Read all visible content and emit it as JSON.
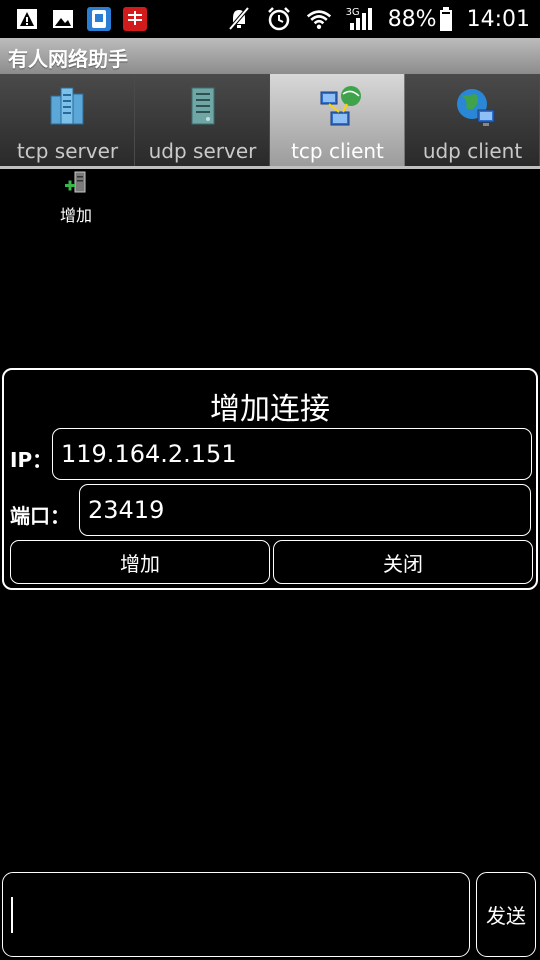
{
  "status_bar": {
    "icons_left": [
      "warning-icon",
      "gallery-icon",
      "app-store-icon",
      "app-badge-icon"
    ],
    "icons_right": [
      "mute-icon",
      "alarm-icon",
      "wifi-icon",
      "signal-icon",
      "battery-icon"
    ],
    "network": "3G",
    "battery": "88%",
    "time": "14:01"
  },
  "app": {
    "title": "有人网络助手"
  },
  "tabs": [
    {
      "label": "tcp server",
      "icon": "server-icon",
      "active": false
    },
    {
      "label": "udp server",
      "icon": "server-rack-icon",
      "active": false
    },
    {
      "label": "tcp client",
      "icon": "network-client-icon",
      "active": true
    },
    {
      "label": "udp client",
      "icon": "globe-client-icon",
      "active": false
    }
  ],
  "toolbar": {
    "add_label": "增加"
  },
  "dialog": {
    "title": "增加连接",
    "ip_label": "IP：",
    "ip_value": "119.164.2.151",
    "port_label": "端口：",
    "port_value": "23419",
    "add_button": "增加",
    "close_button": "关闭"
  },
  "send": {
    "input_value": "",
    "button": "发送"
  },
  "colors": {
    "background": "#000000",
    "active_tab": "#c8c8c8",
    "title_bar": "#a5a5a5"
  }
}
